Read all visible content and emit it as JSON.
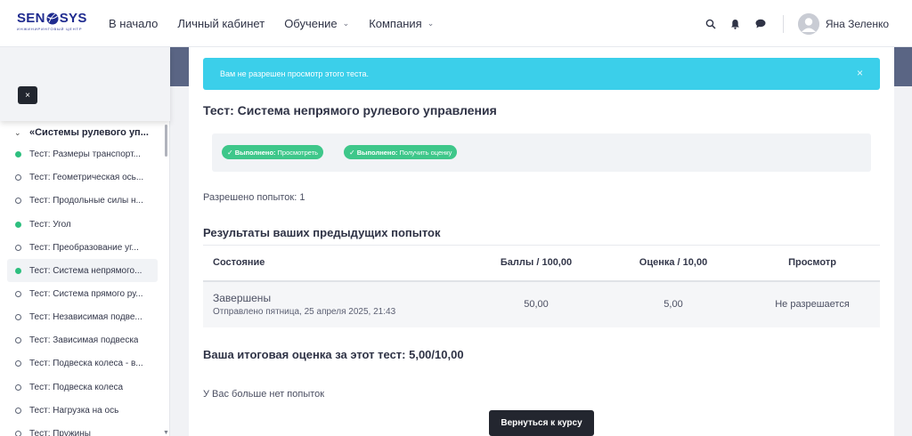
{
  "logo": {
    "text_left": "SEN",
    "text_right": "SYS",
    "subtitle": "ИНЖИНИРИНГОВЫЙ ЦЕНТР"
  },
  "nav": {
    "home": "В начало",
    "cabinet": "Личный кабинет",
    "learning": "Обучение",
    "company": "Компания"
  },
  "user": {
    "name": "Яна Зеленко"
  },
  "icons": [
    "search-icon",
    "bell-icon",
    "chat-icon",
    "chevron-down-icon",
    "close-icon",
    "check-icon"
  ],
  "drawer": {
    "close_label": "×",
    "section": "«Системы рулевого уп...",
    "items": [
      {
        "label": "Тест: Размеры транспорт...",
        "done": true
      },
      {
        "label": "Тест: Геометрическая ось...",
        "done": false
      },
      {
        "label": "Тест: Продольные силы н...",
        "done": false
      },
      {
        "label": "Тест: Угол",
        "done": true
      },
      {
        "label": "Тест: Преобразование уг...",
        "done": false
      },
      {
        "label": "Тест: Система непрямого...",
        "done": true,
        "active": true
      },
      {
        "label": "Тест: Система прямого ру...",
        "done": false
      },
      {
        "label": "Тест: Независимая подве...",
        "done": false
      },
      {
        "label": "Тест: Зависимая подвеска",
        "done": false
      },
      {
        "label": "Тест: Подвеска колеса - в...",
        "done": false
      },
      {
        "label": "Тест: Подвеска колеса",
        "done": false
      },
      {
        "label": "Тест: Нагрузка на ось",
        "done": false
      },
      {
        "label": "Тест: Пружины",
        "done": false
      }
    ]
  },
  "alert": {
    "message": "Вам не разрешен просмотр этого теста.",
    "close": "×"
  },
  "quiz": {
    "title": "Тест: Система непрямого рулевого управления",
    "completion": [
      {
        "status": "Выполнено:",
        "label": "Просмотреть"
      },
      {
        "status": "Выполнено:",
        "label": "Получить оценку"
      }
    ],
    "attempts_allowed": "Разрешено попыток: 1",
    "results_heading": "Результаты ваших предыдущих попыток",
    "table": {
      "headers": [
        "Состояние",
        "Баллы / 100,00",
        "Оценка / 10,00",
        "Просмотр"
      ],
      "rows": [
        {
          "state": "Завершены",
          "submitted": "Отправлено пятница, 25 апреля 2025, 21:43",
          "marks": "50,00",
          "grade": "5,00",
          "review": "Не разрешается"
        }
      ]
    },
    "final_grade": "Ваша итоговая оценка за этот тест: 5,00/10,00",
    "no_more_attempts": "У Вас больше нет попыток",
    "back_button": "Вернуться к курсу"
  },
  "colors": {
    "accent": "#3bcfea",
    "done": "#2ebf7f",
    "brand": "#1f2b8f",
    "header_strip": "#5a6584"
  }
}
